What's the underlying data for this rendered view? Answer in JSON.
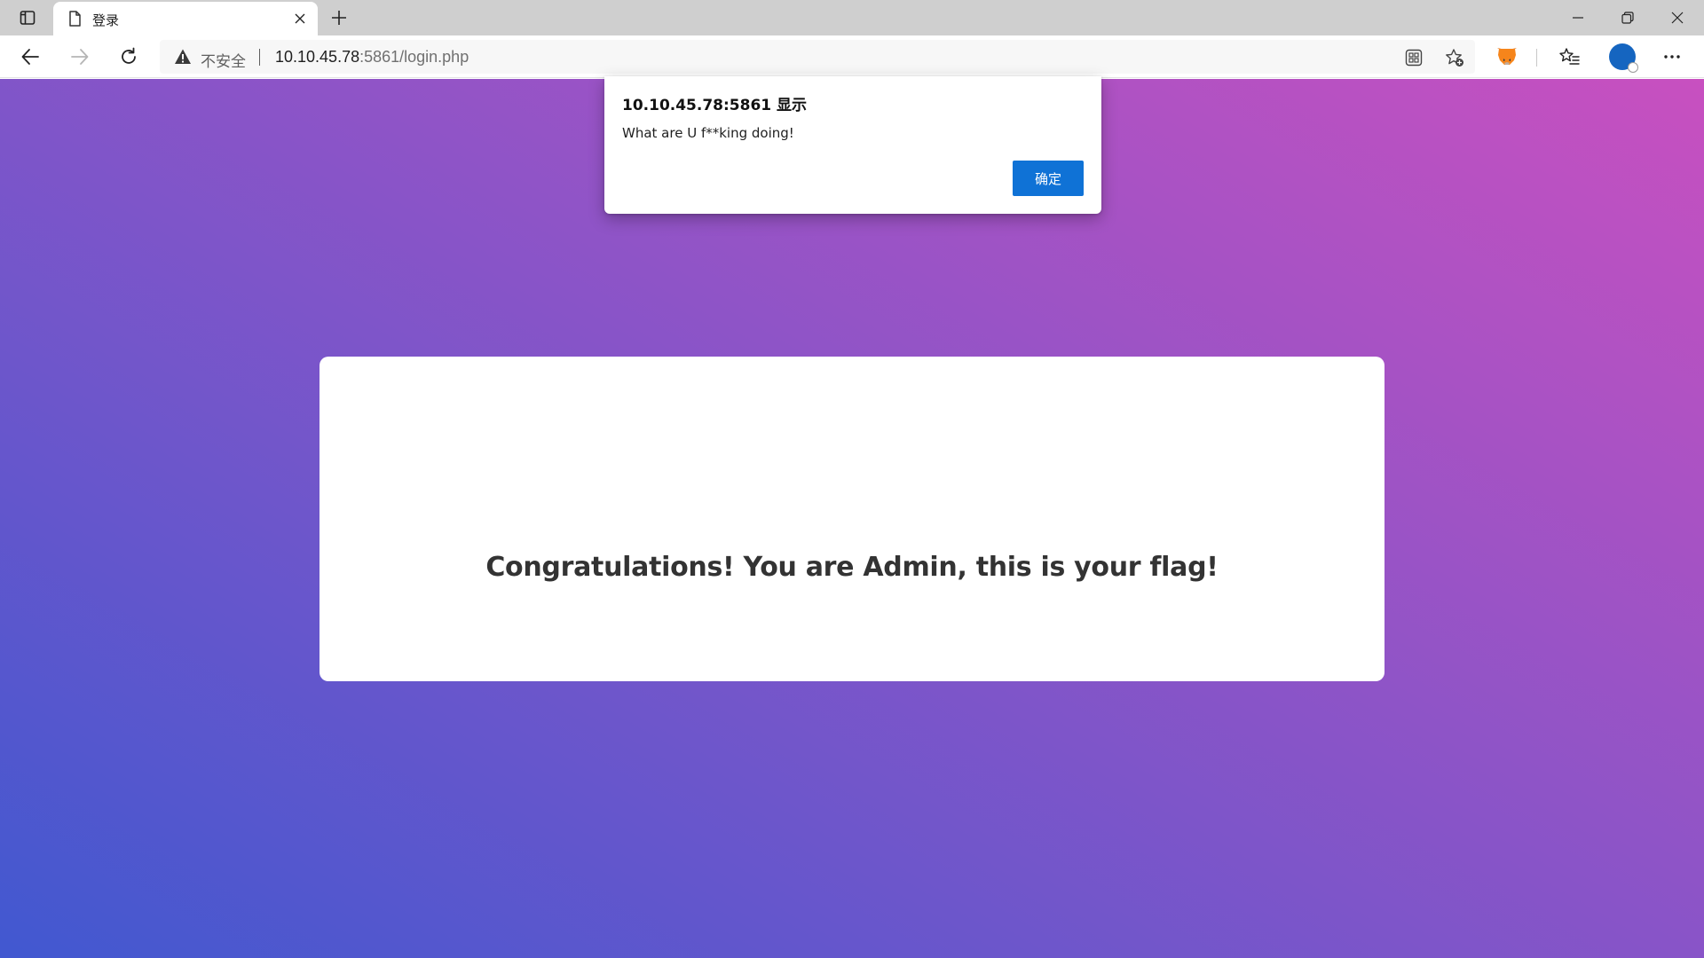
{
  "browser": {
    "tab": {
      "title": "登录",
      "favicon": "page-icon"
    },
    "window_controls": [
      "minimize-icon",
      "restore-icon",
      "close-icon"
    ],
    "address_bar": {
      "security_label": "不安全",
      "url_host": "10.10.45.78",
      "url_rest": ":5861/login.php",
      "warning_icon": "warning-icon"
    },
    "toolbar_icons": [
      "app-available-icon",
      "add-favorite-icon",
      "metamask-extension-icon",
      "favorites-icon",
      "profile-avatar",
      "more-icon"
    ]
  },
  "page": {
    "background_colors": [
      "#4158d0",
      "#c850c0"
    ],
    "card": {
      "message": "Congratulations! You are Admin, this is your flag!"
    }
  },
  "alert": {
    "title": "10.10.45.78:5861 显示",
    "message": "What are U f**king doing!",
    "ok_label": "确定",
    "accent": "#0f72d6"
  }
}
